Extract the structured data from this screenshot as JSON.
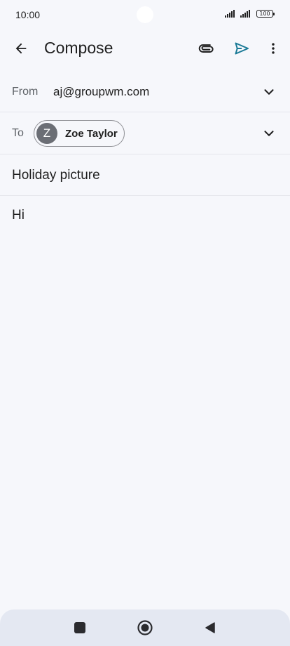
{
  "status_bar": {
    "time": "10:00",
    "battery": "100"
  },
  "app_bar": {
    "title": "Compose"
  },
  "from": {
    "label": "From",
    "value": "aj@groupwm.com"
  },
  "to": {
    "label": "To",
    "recipient": {
      "initial": "Z",
      "name": "Zoe Taylor"
    }
  },
  "subject": "Holiday picture",
  "body": "Hi",
  "icons": {
    "back": "arrow-back-icon",
    "attach": "paperclip-icon",
    "send": "send-icon",
    "more": "more-vert-icon",
    "expand": "chevron-down-icon",
    "nav_recents": "square-icon",
    "nav_home": "circle-icon",
    "nav_back": "triangle-back-icon"
  },
  "colors": {
    "accent": "#1a7a96",
    "background": "#f6f7fb",
    "chip_avatar": "#6b6e75"
  }
}
